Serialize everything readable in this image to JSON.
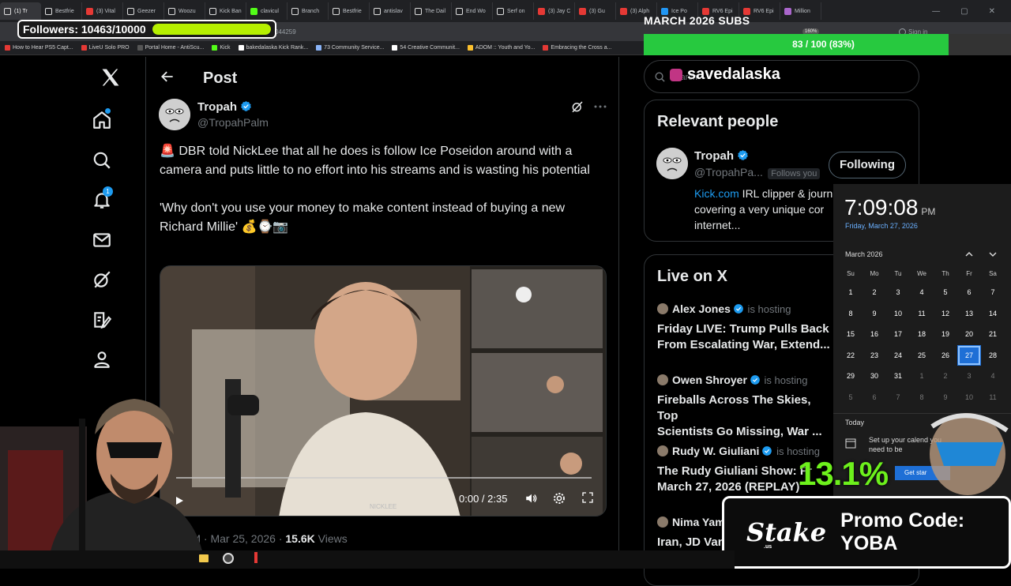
{
  "tabs": [
    {
      "label": "(1) Tr",
      "color": "#ffffff",
      "active": true
    },
    {
      "label": "Bestfrie",
      "color": "#ffffff"
    },
    {
      "label": "(3) Vital",
      "color": "#e53935"
    },
    {
      "label": "Geezer",
      "color": "#ffffff"
    },
    {
      "label": "Woozu",
      "color": "#ffffff"
    },
    {
      "label": "Kick Ban",
      "color": "#ffffff"
    },
    {
      "label": "clavicul",
      "color": "#53fc18"
    },
    {
      "label": "Branch",
      "color": "#ffffff"
    },
    {
      "label": "Bestfrie",
      "color": "#ffffff"
    },
    {
      "label": "antislav",
      "color": "#ffffff"
    },
    {
      "label": "The Dail",
      "color": "#ffffff"
    },
    {
      "label": "End Wo",
      "color": "#ffffff"
    },
    {
      "label": "Serf on",
      "color": "#ffffff"
    },
    {
      "label": "(3) Jay C",
      "color": "#e53935"
    },
    {
      "label": "(3) Gu",
      "color": "#e53935"
    },
    {
      "label": "(3) Alph",
      "color": "#e53935"
    },
    {
      "label": "Ice Po",
      "color": "#2196f3"
    },
    {
      "label": "RV6 Epi",
      "color": "#e53935"
    },
    {
      "label": "RV6 Epi",
      "color": "#e53935"
    },
    {
      "label": "Million",
      "color": "#aa66cc"
    }
  ],
  "address": {
    "url_fragment": "044259",
    "zoom": "160%",
    "signin": "Sign in"
  },
  "bookmarks": [
    {
      "label": "How to Hear PS5 Capt...",
      "color": "#e53935"
    },
    {
      "label": "LiveU Solo PRO",
      "color": "#e53935"
    },
    {
      "label": "Portal Home - AntiScu...",
      "color": "#555555"
    },
    {
      "label": "Kick",
      "color": "#53fc18"
    },
    {
      "label": "bakedalaska Kick Rank...",
      "color": "#ffffff"
    },
    {
      "label": "73 Community Service...",
      "color": "#8ab4f8"
    },
    {
      "label": "54 Creative Communit...",
      "color": "#ffffff"
    },
    {
      "label": "ADOM :: Youth and Yo...",
      "color": "#fbc02d"
    },
    {
      "label": "Embracing the Cross a...",
      "color": "#e53935"
    }
  ],
  "overlays": {
    "followers_label": "Followers: 10463/10000",
    "followers_progress": 1.0,
    "subs_title": "MARCH 2026 SUBS",
    "subs_text": "83 / 100 (83%)",
    "subs_progress": 0.83,
    "percent": "13.1%",
    "promo_logo": "Stake",
    "promo_logo_sub": ".us",
    "promo_code": "Promo Code: YOBA"
  },
  "nav": {
    "notifications_badge": "1"
  },
  "post": {
    "header_title": "Post",
    "author_name": "Tropah",
    "author_handle": "@TropahPalm",
    "text_line1": "🚨 DBR told NickLee that all he does is follow Ice Poseidon around with a camera and puts little to no effort into his streams and is wasting his potential",
    "text_line2": "'Why don't you use your money to make content instead of buying a new Richard Millie' 💰⌚📷",
    "video_time": "0:00 / 2:35",
    "video_watermark": "NICKLEE",
    "meta_time": "PM · Mar 25, 2026 · ",
    "meta_views": "15.6K",
    "meta_views_label": " Views"
  },
  "search": {
    "placeholder": "Search",
    "overlay_handle": "savedalaska"
  },
  "relevant": {
    "title": "Relevant people",
    "name": "Tropah",
    "handle": "@TropahPa...",
    "follows_you": "Follows you",
    "button": "Following",
    "bio_link": "Kick.com",
    "bio_rest": " IRL clipper & journ",
    "bio_line2": "covering a very unique cor",
    "bio_line3": "internet..."
  },
  "live": {
    "title": "Live on X",
    "items": [
      {
        "host": "Alex Jones",
        "status": " is hosting",
        "title1": "Friday LIVE: Trump Pulls Back",
        "title2": "From Escalating War, Extend..."
      },
      {
        "host": "Owen Shroyer",
        "status": " is hosting",
        "title1": "Fireballs Across The Skies, Top",
        "title2": "Scientists Go Missing, War ..."
      },
      {
        "host": "Rudy W. Giuliani",
        "status": " is hosting",
        "title1": "The Rudy Giuliani Show: Fr",
        "title2": "March 27, 2026 (REPLAY)"
      },
      {
        "host": "Nima Yam",
        "status": "",
        "title1": "Iran, JD Van",
        "title2": ""
      }
    ]
  },
  "calendar": {
    "time": "7:09:08",
    "ampm": "PM",
    "date": "Friday, March 27, 2026",
    "month": "March 2026",
    "days_of_week": [
      "Su",
      "Mo",
      "Tu",
      "We",
      "Th",
      "Fr",
      "Sa"
    ],
    "days": [
      {
        "d": "1"
      },
      {
        "d": "2"
      },
      {
        "d": "3"
      },
      {
        "d": "4"
      },
      {
        "d": "5"
      },
      {
        "d": "6"
      },
      {
        "d": "7"
      },
      {
        "d": "8"
      },
      {
        "d": "9"
      },
      {
        "d": "10"
      },
      {
        "d": "11"
      },
      {
        "d": "12"
      },
      {
        "d": "13"
      },
      {
        "d": "14"
      },
      {
        "d": "15"
      },
      {
        "d": "16"
      },
      {
        "d": "17"
      },
      {
        "d": "18"
      },
      {
        "d": "19"
      },
      {
        "d": "20"
      },
      {
        "d": "21"
      },
      {
        "d": "22"
      },
      {
        "d": "23"
      },
      {
        "d": "24"
      },
      {
        "d": "25"
      },
      {
        "d": "26"
      },
      {
        "d": "27",
        "today": true
      },
      {
        "d": "28"
      },
      {
        "d": "29"
      },
      {
        "d": "30"
      },
      {
        "d": "31"
      },
      {
        "d": "1",
        "dim": true
      },
      {
        "d": "2",
        "dim": true
      },
      {
        "d": "3",
        "dim": true
      },
      {
        "d": "4",
        "dim": true
      },
      {
        "d": "5",
        "dim": true
      },
      {
        "d": "6",
        "dim": true
      },
      {
        "d": "7",
        "dim": true
      },
      {
        "d": "8",
        "dim": true
      },
      {
        "d": "9",
        "dim": true
      },
      {
        "d": "10",
        "dim": true
      },
      {
        "d": "11",
        "dim": true
      }
    ],
    "today_label": "Today",
    "setup_text": "Set up your calend you need to be",
    "get_started": "Get star"
  },
  "colors": {
    "x_blue": "#1d9bf0",
    "followers_bar": "#b6f000",
    "subs_bar": "#27c93f",
    "percent_green": "#6df01c"
  }
}
